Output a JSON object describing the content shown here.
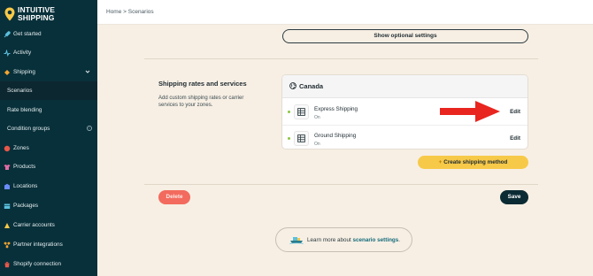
{
  "app": {
    "logo_line1": "INTUITIVE",
    "logo_line2": "SHIPPING",
    "brand_color": "#f7c948"
  },
  "sidebar": {
    "items": [
      {
        "label": "Get started",
        "icon": "rocket-icon"
      },
      {
        "label": "Activity",
        "icon": "activity-icon"
      },
      {
        "label": "Shipping",
        "icon": "shipping-icon",
        "expanded": true
      },
      {
        "label": "Scenarios",
        "sub": true,
        "active": true
      },
      {
        "label": "Rate blending",
        "sub": true
      },
      {
        "label": "Condition groups",
        "sub": true
      },
      {
        "label": "Zones",
        "icon": "zones-icon"
      },
      {
        "label": "Products",
        "icon": "products-icon"
      },
      {
        "label": "Locations",
        "icon": "locations-icon"
      },
      {
        "label": "Packages",
        "icon": "packages-icon"
      },
      {
        "label": "Carrier accounts",
        "icon": "carrier-icon"
      },
      {
        "label": "Partner integrations",
        "icon": "partner-icon"
      },
      {
        "label": "Shopify connection",
        "icon": "shopify-icon"
      }
    ]
  },
  "header": {
    "breadcrumb": "Home > Scenarios"
  },
  "main": {
    "optional_settings_label": "Show optional settings",
    "section_title": "Shipping rates and services",
    "section_desc": "Add custom shipping rates or carrier services to your zones.",
    "zone_name": "Canada",
    "rates": [
      {
        "name": "Express Shipping",
        "status": "On",
        "edit_label": "Edit"
      },
      {
        "name": "Ground Shipping",
        "status": "On",
        "edit_label": "Edit"
      }
    ],
    "create_label": "Create shipping method",
    "delete_label": "Delete",
    "save_label": "Save",
    "learn_prefix": "Learn more about",
    "learn_link": "scenario settings",
    "learn_suffix": "."
  }
}
